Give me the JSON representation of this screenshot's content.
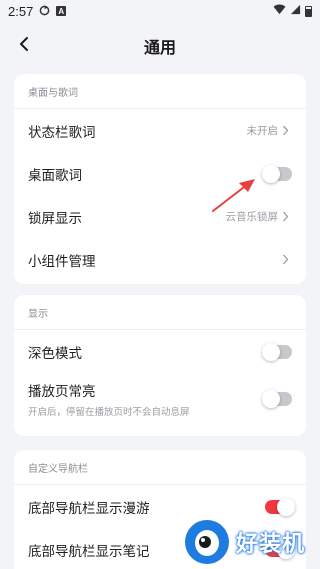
{
  "status_bar": {
    "time": "2:57",
    "icons": [
      "sync-icon",
      "a-badge-icon",
      "wifi-icon",
      "signal-icon",
      "battery-icon"
    ],
    "a_badge": "A"
  },
  "header": {
    "title": "通用",
    "back_icon": "chevron-left-icon"
  },
  "sections": {
    "desktop": {
      "title": "桌面与歌词",
      "status_lyrics": {
        "label": "状态栏歌词",
        "value": "未开启"
      },
      "desktop_lyrics": {
        "label": "桌面歌词",
        "enabled": false
      },
      "lock_screen": {
        "label": "锁屏显示",
        "value": "云音乐锁屏"
      },
      "widget": {
        "label": "小组件管理"
      }
    },
    "display": {
      "title": "显示",
      "dark_mode": {
        "label": "深色模式",
        "enabled": false
      },
      "keep_awake": {
        "label": "播放页常亮",
        "desc": "开启后，停留在播放页时不会自动息屏",
        "enabled": false
      }
    },
    "nav": {
      "title": "自定义导航栏",
      "show_roam": {
        "label": "底部导航栏显示漫游",
        "enabled": true
      },
      "show_notes": {
        "label": "底部导航栏显示笔记",
        "enabled": true
      }
    }
  },
  "annotation": {
    "type": "arrow",
    "color": "#e8403e"
  },
  "watermark": {
    "text": "好装机"
  },
  "colors": {
    "accent": "#f0383f",
    "background": "#f3f4f8",
    "card": "#ffffff",
    "secondary_text": "#9a9ca3"
  }
}
